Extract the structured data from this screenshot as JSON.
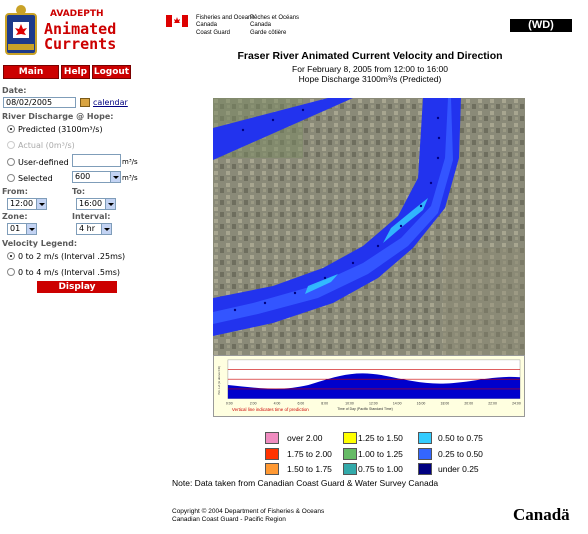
{
  "app": {
    "brand_small": "AVADEPTH",
    "brand_line1": "Animated",
    "brand_line2": "Currents"
  },
  "nav": {
    "main_menu": "Main Menu",
    "help": "Help",
    "logout": "Logout"
  },
  "form": {
    "date_label": "Date:",
    "date_value": "08/02/2005",
    "calendar_link": "calendar",
    "discharge_label": "River Discharge @ Hope:",
    "predicted_option": "Predicted (3100m³/s)",
    "actual_option": "Actual (0m³/s)",
    "user_defined_option": "User-defined",
    "user_defined_value": "",
    "selected_option": "Selected",
    "selected_value": "600",
    "unit": "m³/s",
    "from_label": "From:",
    "from_value": "12:00",
    "to_label": "To:",
    "to_value": "16:00",
    "zone_label": "Zone:",
    "zone_value": "01",
    "interval_label": "Interval:",
    "interval_value": "4 hr",
    "velocity_label": "Velocity Legend:",
    "velocity_opt1": "0 to 2 m/s (Interval .25ms)",
    "velocity_opt2": "0 to 4 m/s (Interval .5ms)",
    "display_button": "Display"
  },
  "header": {
    "dept_en_1": "Fisheries and Oceans",
    "dept_en_2": "Canada",
    "dept_fr_1": "Pêches et Océans",
    "dept_fr_2": "Canada",
    "cg_en": "Coast Guard",
    "cg_fr": "Garde côtière",
    "wd_badge": "(WD)"
  },
  "title": {
    "line1": "Fraser River Animated Current Velocity and Direction",
    "line2": "For February 8, 2005 from 12:00 to 16:00",
    "line3": "Hope Discharge 3100m³/s (Predicted)"
  },
  "tide_graph": {
    "ylabel": "Wtr. Lvl (m above CD)",
    "xlabel": "Time of Day (Pacific Standard Time)",
    "caption": "Vertical line indicates time of prediction",
    "ticks": [
      "0:00",
      "2:00",
      "4:00",
      "6:00",
      "8:00",
      "10:00",
      "12:00",
      "14:00",
      "16:00",
      "18:00",
      "20:00",
      "22:00",
      "24:00"
    ]
  },
  "legend": [
    {
      "label": "over 2.00",
      "color": "#f08cc0",
      "col": 0
    },
    {
      "label": "1.75 to 2.00",
      "color": "#ff3300",
      "col": 0
    },
    {
      "label": "1.50 to 1.75",
      "color": "#ff9933",
      "col": 0
    },
    {
      "label": "1.25 to 1.50",
      "color": "#ffff00",
      "col": 1
    },
    {
      "label": "1.00 to 1.25",
      "color": "#66bb66",
      "col": 1
    },
    {
      "label": "0.75 to 1.00",
      "color": "#33aaaa",
      "col": 1
    },
    {
      "label": "0.50 to 0.75",
      "color": "#33ccff",
      "col": 2
    },
    {
      "label": "0.25 to 0.50",
      "color": "#3366ff",
      "col": 2
    },
    {
      "label": "under 0.25",
      "color": "#000080",
      "col": 2
    }
  ],
  "note": "Note: Data taken from Canadian Coast Guard & Water Survey Canada",
  "footer": {
    "copyright": "Copyright © 2004 Department of Fisheries & Oceans",
    "subline": "Canadian Coast Guard - Pacific Region",
    "wordmark": "Canadä"
  }
}
